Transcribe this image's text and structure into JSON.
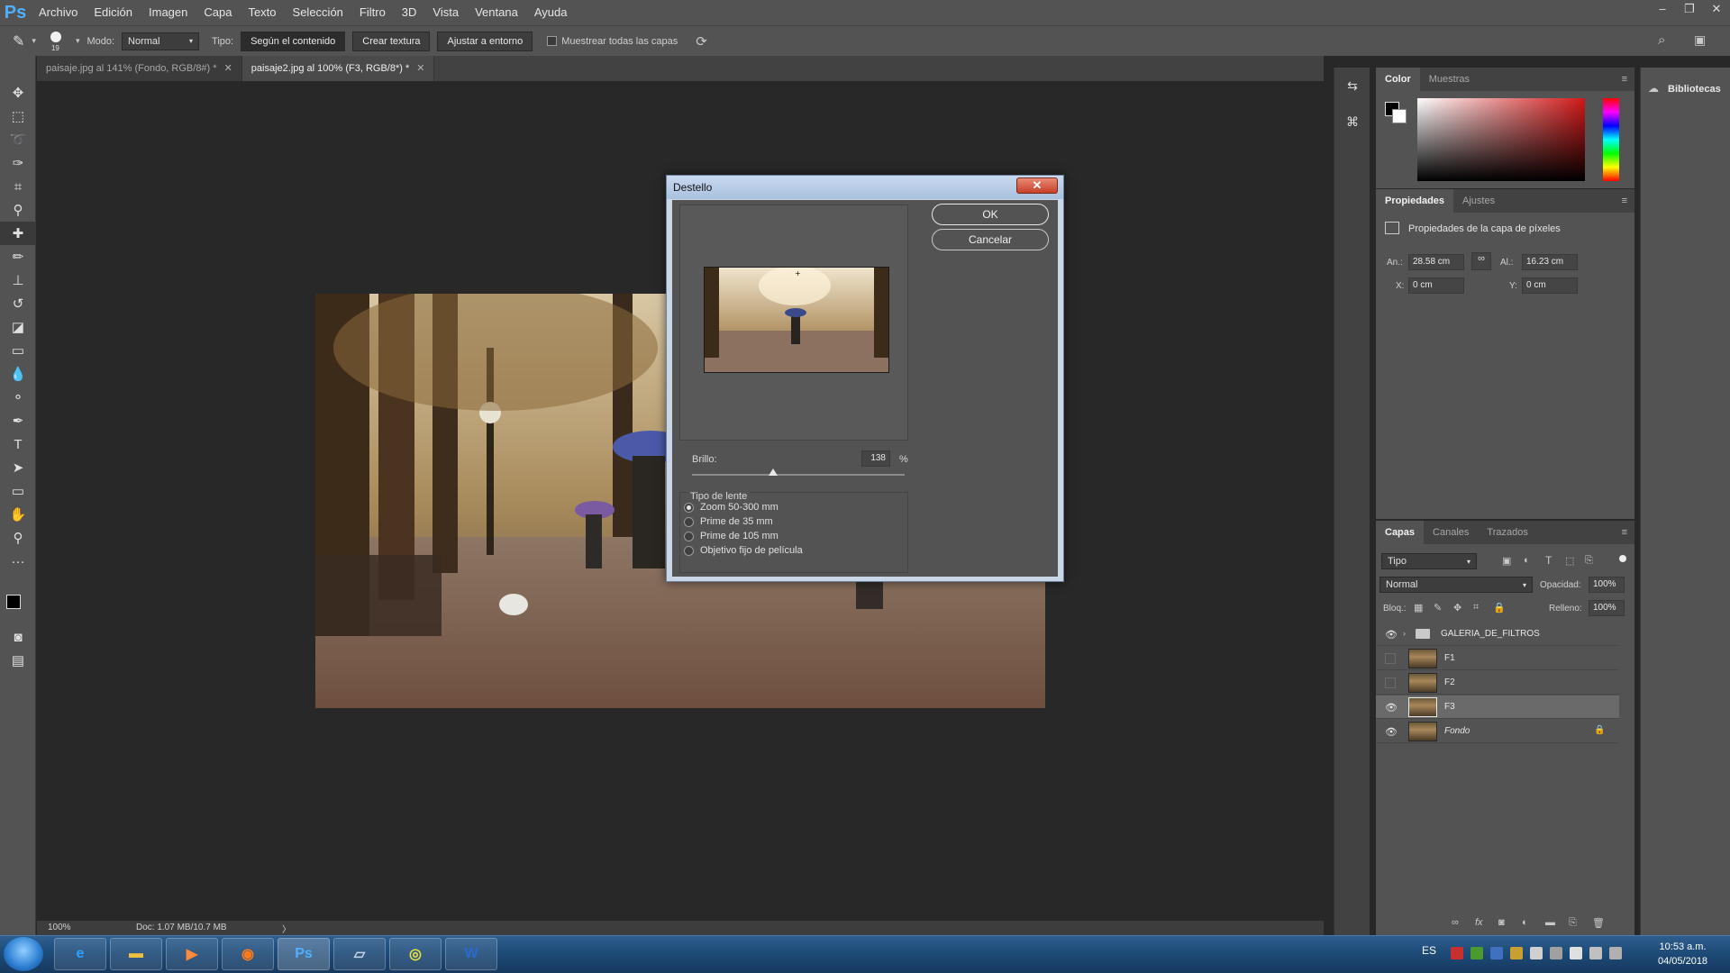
{
  "app": {
    "logo": "Ps"
  },
  "menu": [
    "Archivo",
    "Edición",
    "Imagen",
    "Capa",
    "Texto",
    "Selección",
    "Filtro",
    "3D",
    "Vista",
    "Ventana",
    "Ayuda"
  ],
  "window_controls": {
    "minimize": "–",
    "restore": "❐",
    "close": "✕"
  },
  "options": {
    "brush_size": "19",
    "mode_label": "Modo:",
    "mode_value": "Normal",
    "type_label": "Tipo:",
    "type_buttons": [
      "Según el contenido",
      "Crear textura",
      "Ajustar a entorno"
    ],
    "sample_all_label": "Muestrear todas las capas"
  },
  "doc_tabs": [
    {
      "label": "paisaje.jpg al 141% (Fondo, RGB/8#) *",
      "active": false
    },
    {
      "label": "paisaje2.jpg al 100% (F3, RGB/8*) *",
      "active": true
    }
  ],
  "status": {
    "zoom": "100%",
    "doc": "Doc: 1.07 MB/10.7 MB"
  },
  "color_panel": {
    "tabs": [
      "Color",
      "Muestras"
    ]
  },
  "properties_panel": {
    "tabs": [
      "Propiedades",
      "Ajustes"
    ],
    "title": "Propiedades de la capa de píxeles",
    "w_label": "An.:",
    "w_value": "28.58 cm",
    "h_label": "Al.:",
    "h_value": "16.23 cm",
    "x_label": "X:",
    "x_value": "0 cm",
    "y_label": "Y:",
    "y_value": "0 cm"
  },
  "layers_panel": {
    "tabs": [
      "Capas",
      "Canales",
      "Trazados"
    ],
    "filter_kind": "Tipo",
    "blend_mode": "Normal",
    "opacity_label": "Opacidad:",
    "opacity_value": "100%",
    "lock_label": "Bloq.:",
    "fill_label": "Relleno:",
    "fill_value": "100%",
    "layers": [
      {
        "name": "GALERIA_DE_FILTROS",
        "visible": true,
        "group": true,
        "selected": false
      },
      {
        "name": "F1",
        "visible": false,
        "group": false,
        "selected": false
      },
      {
        "name": "F2",
        "visible": false,
        "group": false,
        "selected": false
      },
      {
        "name": "F3",
        "visible": true,
        "group": false,
        "selected": true
      },
      {
        "name": "Fondo",
        "visible": true,
        "group": false,
        "selected": false,
        "locked": true
      }
    ]
  },
  "libraries": {
    "label": "Bibliotecas"
  },
  "dialog": {
    "title": "Destello",
    "ok": "OK",
    "cancel": "Cancelar",
    "brightness_label": "Brillo:",
    "brightness_value": "138",
    "brightness_unit": "%",
    "brightness_fraction": 0.38,
    "lens_group_title": "Tipo de lente",
    "lens_options": [
      "Zoom 50-300 mm",
      "Prime de 35 mm",
      "Prime de 105 mm",
      "Objetivo fijo de película"
    ],
    "lens_selected": 0
  },
  "taskbar": {
    "lang": "ES",
    "time": "10:53 a.m.",
    "date": "04/05/2018"
  },
  "colors": {
    "ui_dark": "#282828",
    "ui_panel": "#535353",
    "accent_ps": "#4fb0ff"
  }
}
